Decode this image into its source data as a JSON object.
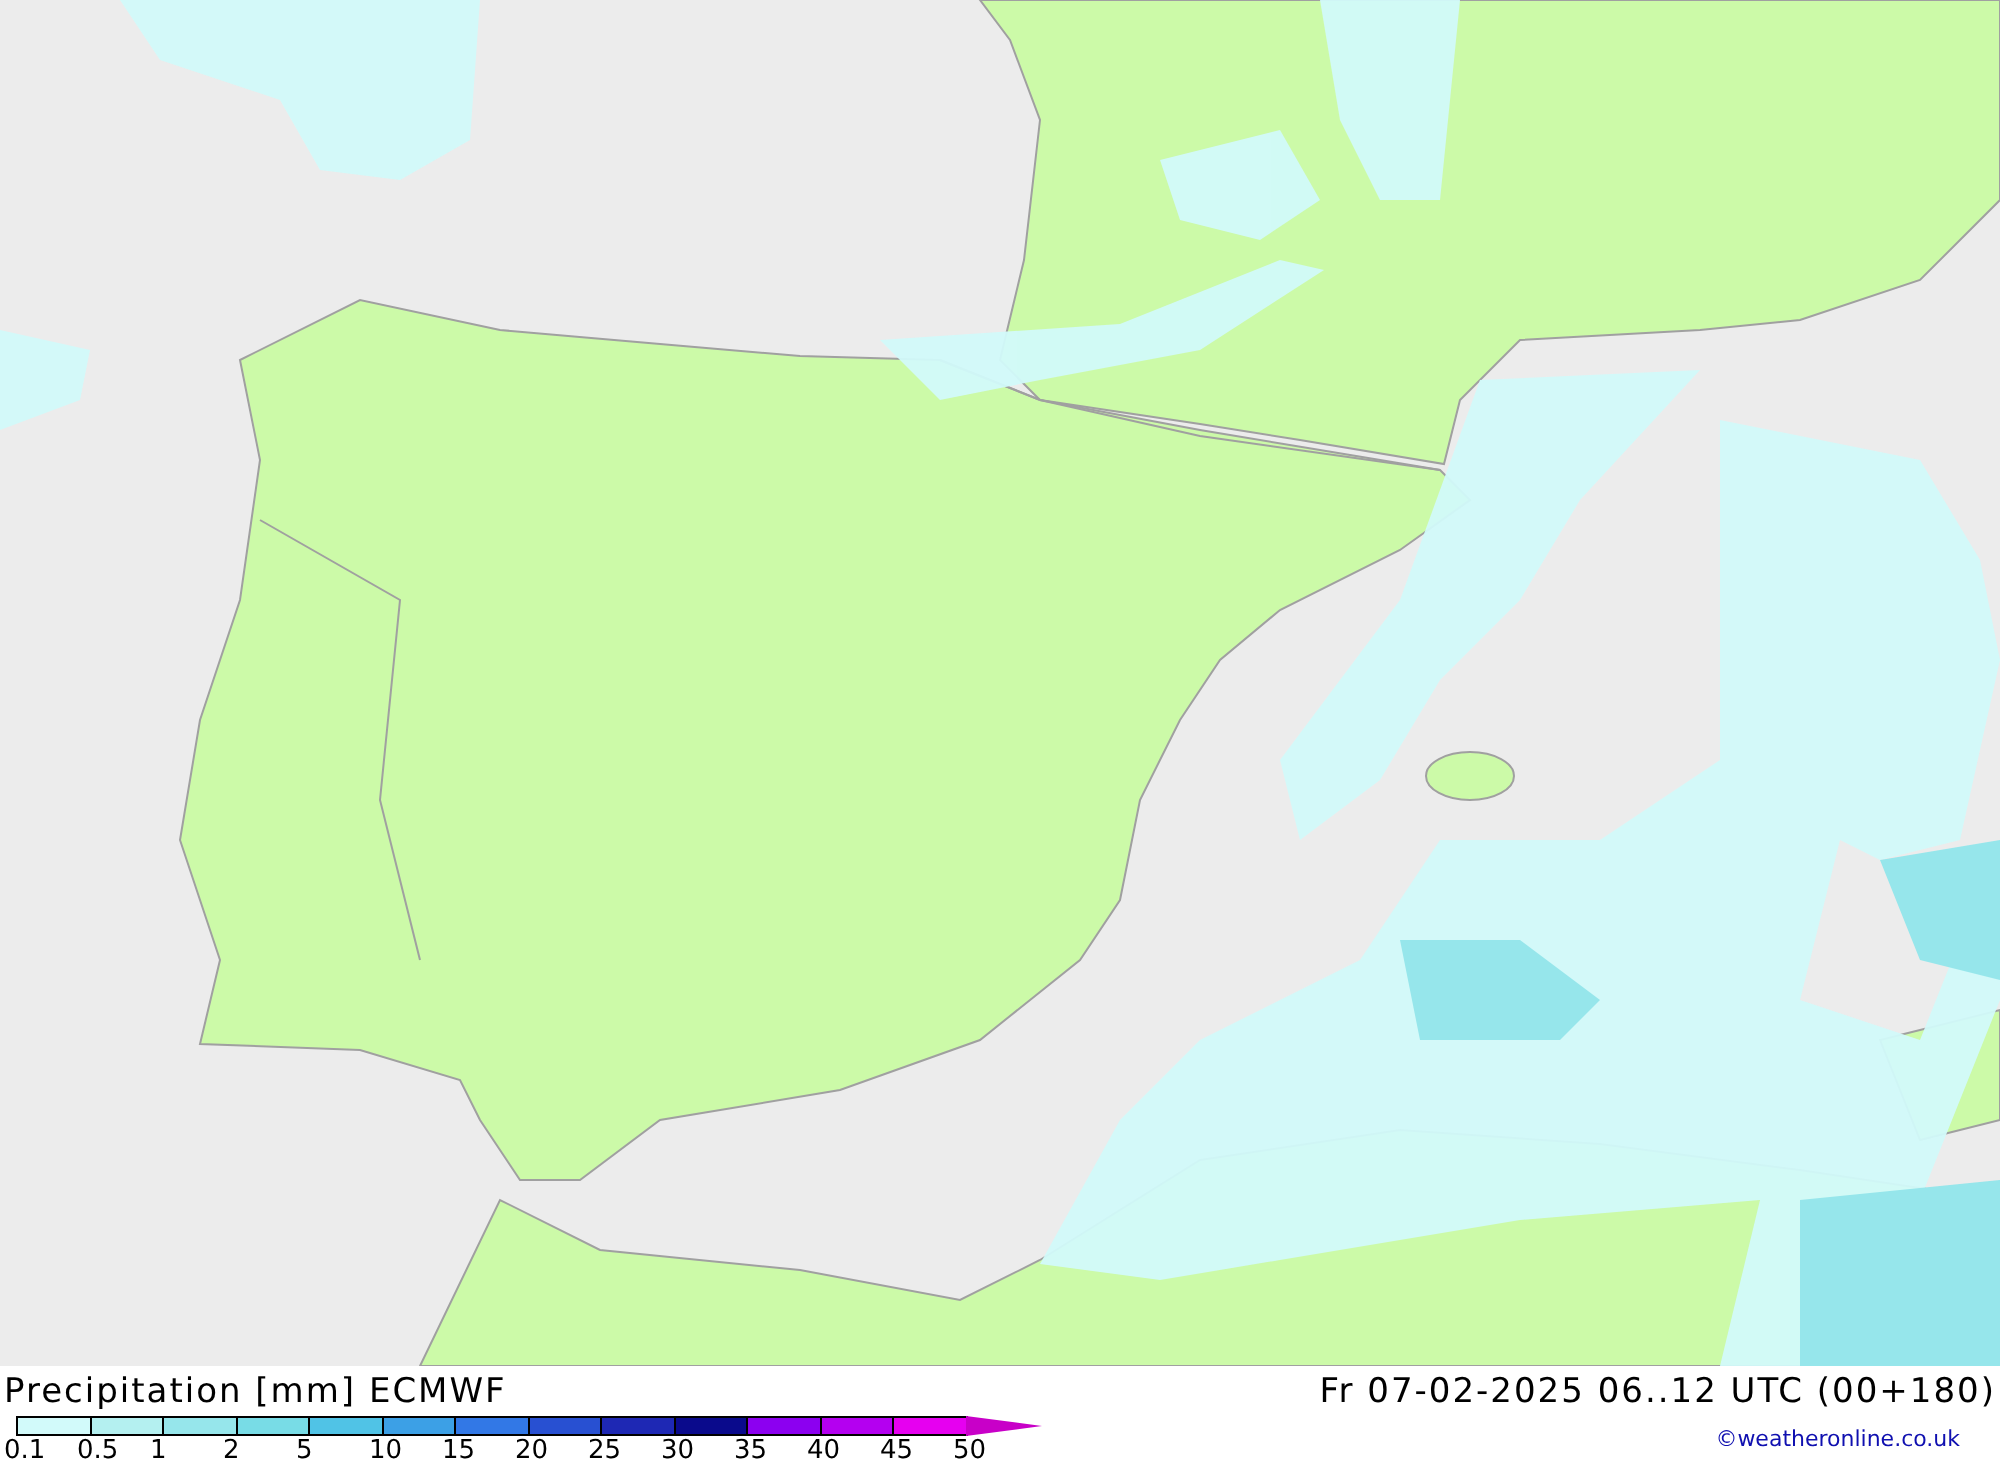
{
  "title": "Precipitation [mm] ECMWF",
  "valid_time": "Fr 07-02-2025 06..12 UTC (00+180)",
  "legend": [
    {
      "label": "0.1",
      "color": "#d2fafa",
      "kind": "box"
    },
    {
      "label": "0.5",
      "color": "#b4f0f0",
      "kind": "box"
    },
    {
      "label": "1",
      "color": "#96e6eb",
      "kind": "box"
    },
    {
      "label": "2",
      "color": "#78dce6",
      "kind": "box"
    },
    {
      "label": "5",
      "color": "#50c3e6",
      "kind": "box"
    },
    {
      "label": "10",
      "color": "#3ca0e6",
      "kind": "box"
    },
    {
      "label": "15",
      "color": "#3278e6",
      "kind": "box"
    },
    {
      "label": "20",
      "color": "#2850d2",
      "kind": "box"
    },
    {
      "label": "25",
      "color": "#1e28b4",
      "kind": "box"
    },
    {
      "label": "30",
      "color": "#0a0a8c",
      "kind": "box"
    },
    {
      "label": "35",
      "color": "#8c00f0",
      "kind": "box"
    },
    {
      "label": "40",
      "color": "#b400f0",
      "kind": "box"
    },
    {
      "label": "45",
      "color": "#e600f0",
      "kind": "box"
    },
    {
      "label": "50",
      "color": "#c800c8",
      "kind": "arrow"
    }
  ],
  "credit": "©weatheronline.co.uk"
}
